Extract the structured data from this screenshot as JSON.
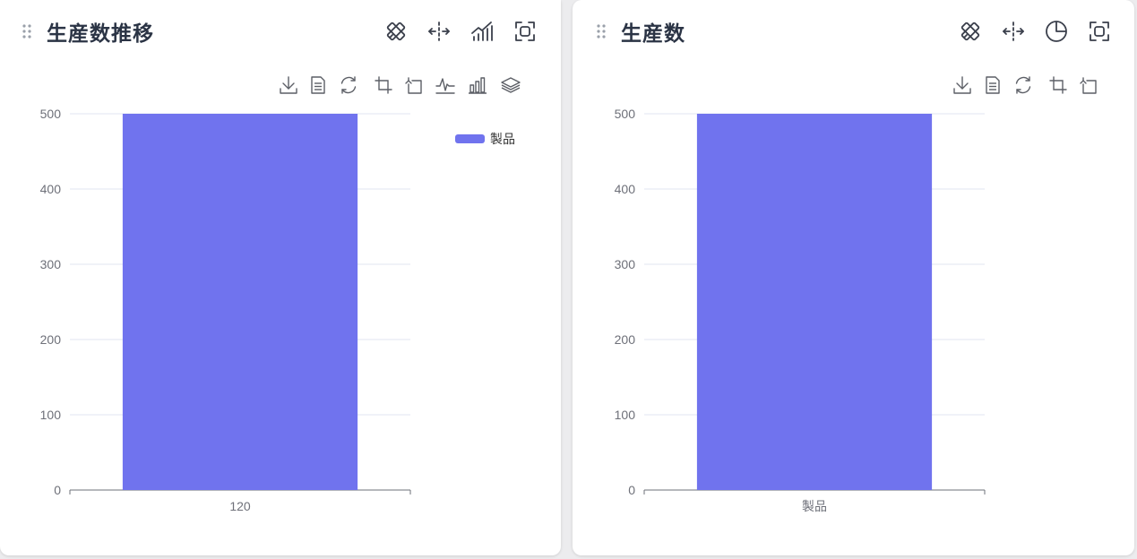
{
  "colors": {
    "bar": "#7073ee",
    "axis": "#6e7079",
    "grid": "#e0e6f1",
    "title": "#2b3445",
    "icon": "#3a3f4b",
    "tool_icon": "#5c5f66"
  },
  "left_panel": {
    "title": "生産数推移",
    "header_icons": [
      "edit-pencil-ruler-icon",
      "split-horizontal-icon",
      "line-bar-trend-icon",
      "fullscreen-focus-icon"
    ],
    "toolbox_icons": [
      "download-icon",
      "data-view-icon",
      "restore-icon",
      "zoom-icon",
      "zoom-reset-icon",
      "line-switch-icon",
      "bar-switch-icon",
      "stack-switch-icon"
    ],
    "legend": [
      "製品"
    ]
  },
  "right_panel": {
    "title": "生産数",
    "header_icons": [
      "edit-pencil-ruler-icon",
      "split-horizontal-icon",
      "pie-chart-icon",
      "fullscreen-focus-icon"
    ],
    "toolbox_icons": [
      "download-icon",
      "data-view-icon",
      "restore-icon",
      "zoom-icon",
      "zoom-reset-icon"
    ]
  },
  "chart_data": [
    {
      "type": "bar",
      "categories": [
        "120"
      ],
      "series": [
        {
          "name": "製品",
          "values": [
            500
          ]
        }
      ],
      "ylim": [
        0,
        500
      ],
      "yticks": [
        0,
        100,
        200,
        300,
        400,
        500
      ],
      "grid": true,
      "legend_position": "top-right"
    },
    {
      "type": "bar",
      "categories": [
        "製品"
      ],
      "series": [
        {
          "values": [
            500
          ]
        }
      ],
      "ylim": [
        0,
        500
      ],
      "yticks": [
        0,
        100,
        200,
        300,
        400,
        500
      ],
      "grid": true
    }
  ]
}
